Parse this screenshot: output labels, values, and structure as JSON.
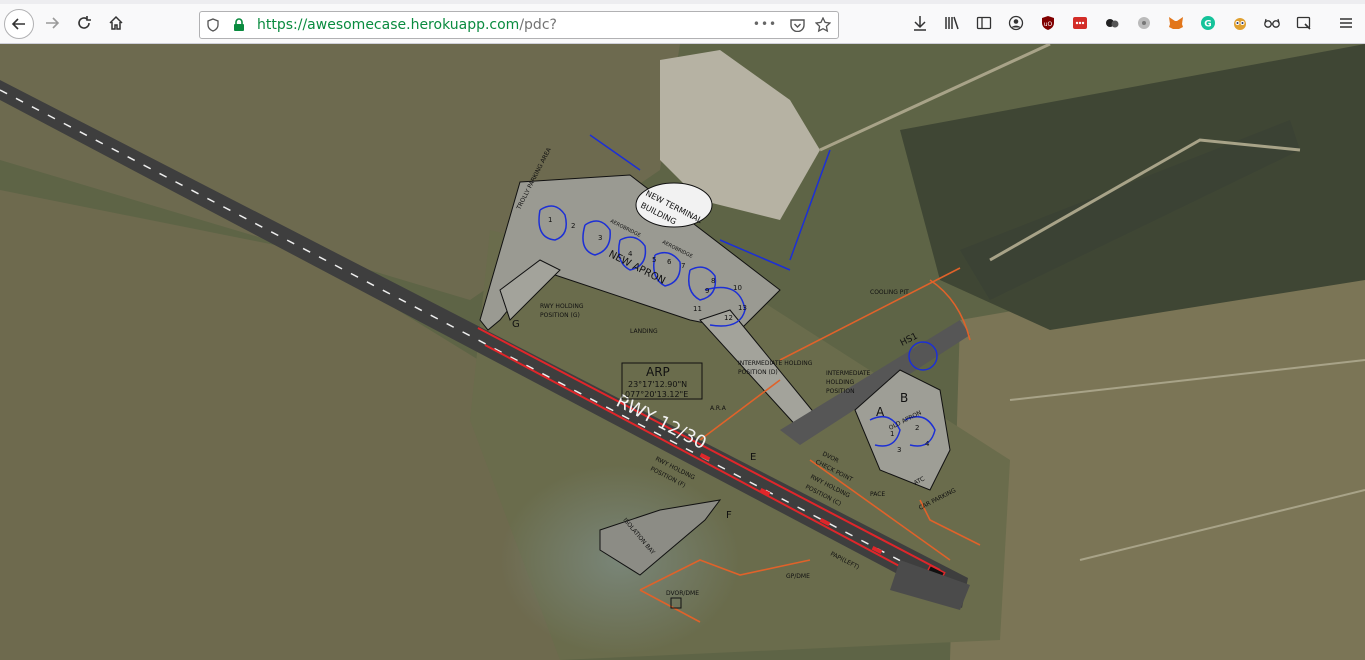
{
  "browser": {
    "url_domain": "https://awesomecase.herokuapp.com",
    "url_path": "/pdc?",
    "page_actions": "•••"
  },
  "map": {
    "labels": {
      "runway": "RWY 12/30",
      "terminal_line1": "NEW TERMINAL",
      "terminal_line2": "BUILDING",
      "new_apron": "NEW APRON",
      "trolley_parking": "TROLLY PARKING AREA",
      "aerobridge_1": "AEROBRIDGE",
      "aerobridge_2": "AEROBRIDGE",
      "arp": "ARP",
      "arp_lat": "23°17'12.90\"N",
      "arp_lon": "077°20'13.12\"E",
      "landing": "LANDING",
      "holding_g": "RWY HOLDING",
      "holding_g2": "POSITION (G)",
      "holding_d": "INTERMEDIATE HOLDING",
      "holding_d2": "POSITION (D)",
      "holding_int": "INTERMEDIATE",
      "holding_int2": "HOLDING",
      "holding_int3": "POSITION",
      "holding_f": "RWY HOLDING",
      "holding_f2": "POSITION (F)",
      "holding_c": "RWY HOLDING",
      "holding_c2": "POSITION (C)",
      "dvor_check": "DVOR",
      "dvor_check2": "CHECK POINT",
      "isolation_bay": "ISOLATION BAY",
      "dvor_dme": "DVOR/DME",
      "gp_dme": "GP/DME",
      "papi": "PAPI(LEFT)",
      "cooling_pit": "COOLING PIT",
      "hs1": "HS1",
      "old_apron": "OLD APRON",
      "atc": "ATC",
      "car_parking": "CAR PARKING",
      "pace": "PACE",
      "ara": "A.R.A",
      "twy_a": "A",
      "twy_b": "B",
      "twy_e": "E",
      "twy_f": "F",
      "twy_g": "G"
    },
    "stand_numbers": [
      "1",
      "2",
      "3",
      "4",
      "5",
      "6",
      "7",
      "8",
      "9",
      "10",
      "11",
      "12",
      "13"
    ],
    "old_stand_numbers": [
      "1",
      "2",
      "3",
      "4"
    ]
  },
  "colors": {
    "runway_marking": "#e0262a",
    "taxi_lines": "#1c2fd6",
    "boundary": "#e0622a"
  }
}
